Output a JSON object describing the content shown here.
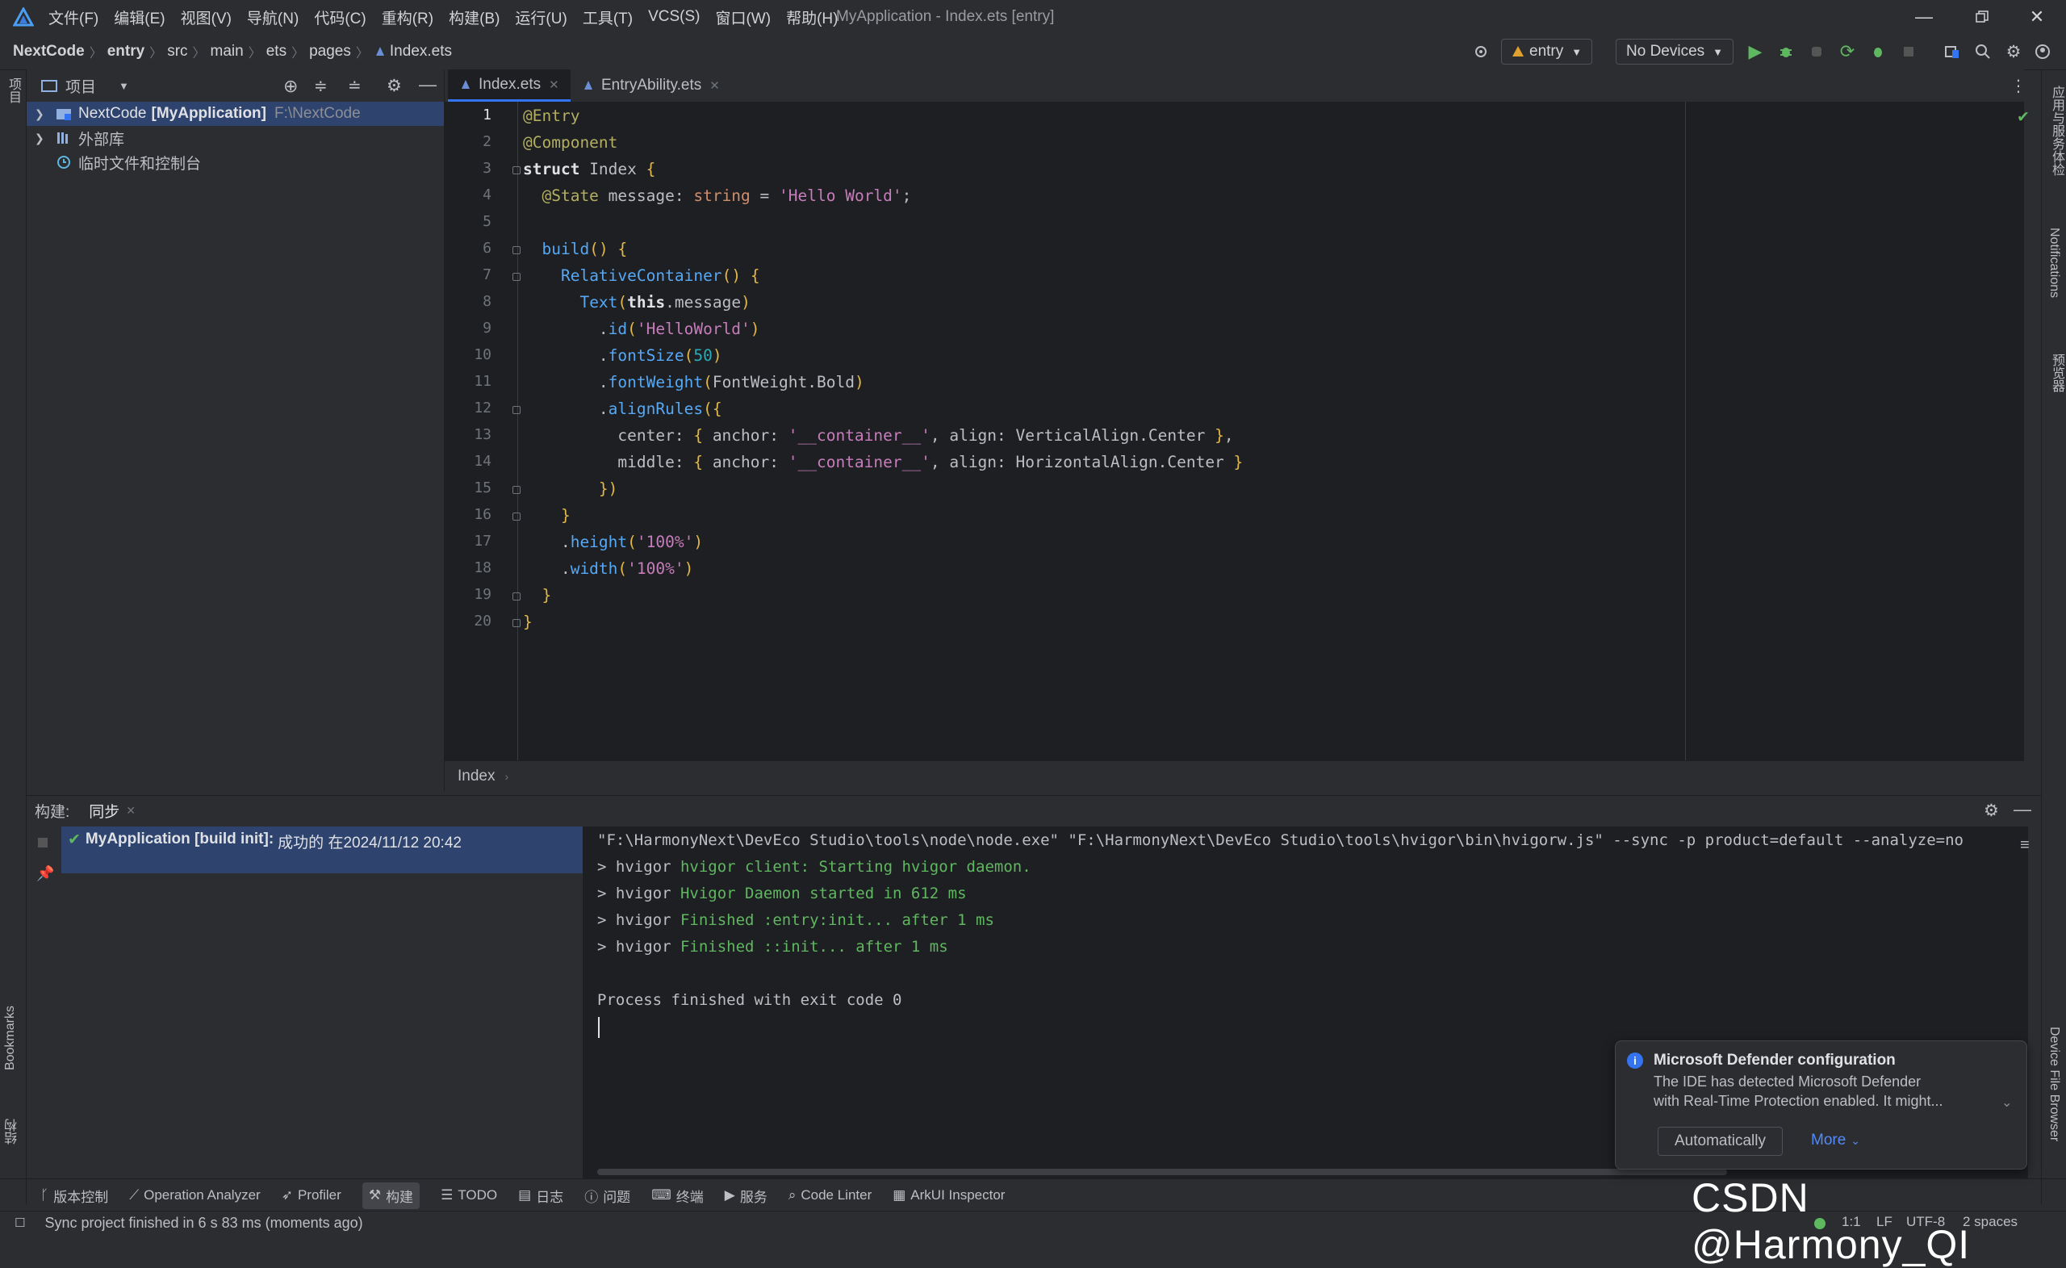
{
  "window": {
    "title": "MyApplication - Index.ets [entry]",
    "menu": [
      "文件(F)",
      "编辑(E)",
      "视图(V)",
      "导航(N)",
      "代码(C)",
      "重构(R)",
      "构建(B)",
      "运行(U)",
      "工具(T)",
      "VCS(S)",
      "窗口(W)",
      "帮助(H)"
    ]
  },
  "breadcrumb": [
    "NextCode",
    "entry",
    "src",
    "main",
    "ets",
    "pages",
    "Index.ets"
  ],
  "run_config": {
    "module": "entry",
    "device": "No Devices"
  },
  "project_panel": {
    "title": "项目",
    "tree": [
      {
        "name": "NextCode",
        "module": "[MyApplication]",
        "path": "F:\\NextCode"
      },
      {
        "name": "外部库"
      },
      {
        "name": "临时文件和控制台"
      }
    ]
  },
  "editor": {
    "tabs": [
      {
        "label": "Index.ets",
        "active": true
      },
      {
        "label": "EntryAbility.ets",
        "active": false
      }
    ],
    "line_numbers": [
      "1",
      "2",
      "3",
      "4",
      "5",
      "6",
      "7",
      "8",
      "9",
      "10",
      "11",
      "12",
      "13",
      "14",
      "15",
      "16",
      "17",
      "18",
      "19",
      "20"
    ],
    "code_lines": [
      "@Entry",
      "@Component",
      "struct Index {",
      "  @State message: string = 'Hello World';",
      "",
      "  build() {",
      "    RelativeContainer() {",
      "      Text(this.message)",
      "        .id('HelloWorld')",
      "        .fontSize(50)",
      "        .fontWeight(FontWeight.Bold)",
      "        .alignRules({",
      "          center: { anchor: '__container__', align: VerticalAlign.Center },",
      "          middle: { anchor: '__container__', align: HorizontalAlign.Center }",
      "        })",
      "    }",
      "    .height('100%')",
      "    .width('100%')",
      "  }",
      "}"
    ],
    "breadcrumb": "Index"
  },
  "right_strip": [
    "应用与服务体检",
    "Notifications",
    "预览器",
    "Device File Browser"
  ],
  "left_strip": [
    "项目",
    "Bookmarks",
    "结构"
  ],
  "build_panel": {
    "label": "构建:",
    "tab": "同步",
    "tree_item": {
      "title": "MyApplication [build init]:",
      "status": "成功的 在2024/11/12 20:42"
    },
    "console_lines": [
      {
        "text": "\"F:\\HarmonyNext\\DevEco Studio\\tools\\node\\node.exe\" \"F:\\HarmonyNext\\DevEco Studio\\tools\\hvigor\\bin\\hvigorw.js\" --sync -p product=default --analyze=no",
        "prefix": ""
      },
      {
        "prefix": "> hvigor ",
        "text": "hvigor client: Starting hvigor daemon."
      },
      {
        "prefix": "> hvigor ",
        "text": "Hvigor Daemon started in 612 ms"
      },
      {
        "prefix": "> hvigor ",
        "text": "Finished :entry:init... after 1 ms"
      },
      {
        "prefix": "> hvigor ",
        "text": "Finished ::init... after 1 ms"
      },
      {
        "prefix": "",
        "text": ""
      },
      {
        "prefix": "",
        "text": "Process finished with exit code 0"
      }
    ]
  },
  "notification": {
    "title": "Microsoft Defender configuration",
    "body_line1": "The IDE has detected Microsoft Defender",
    "body_line2": "with Real-Time Protection enabled. It might...",
    "action": "Automatically",
    "more": "More"
  },
  "tool_windows": [
    "版本控制",
    "Operation Analyzer",
    "Profiler",
    "构建",
    "TODO",
    "日志",
    "问题",
    "终端",
    "服务",
    "Code Linter",
    "ArkUI Inspector"
  ],
  "status": {
    "message": "Sync project finished in 6 s 83 ms (moments ago)",
    "position": "1:1",
    "line_sep": "LF",
    "encoding": "UTF-8",
    "indent": "2 spaces"
  },
  "watermark": "CSDN @Harmony_QI",
  "colors": {
    "accent": "#3574f0",
    "selection": "#2e436e",
    "success": "#5fb760",
    "editor_bg": "#1e1f22"
  }
}
